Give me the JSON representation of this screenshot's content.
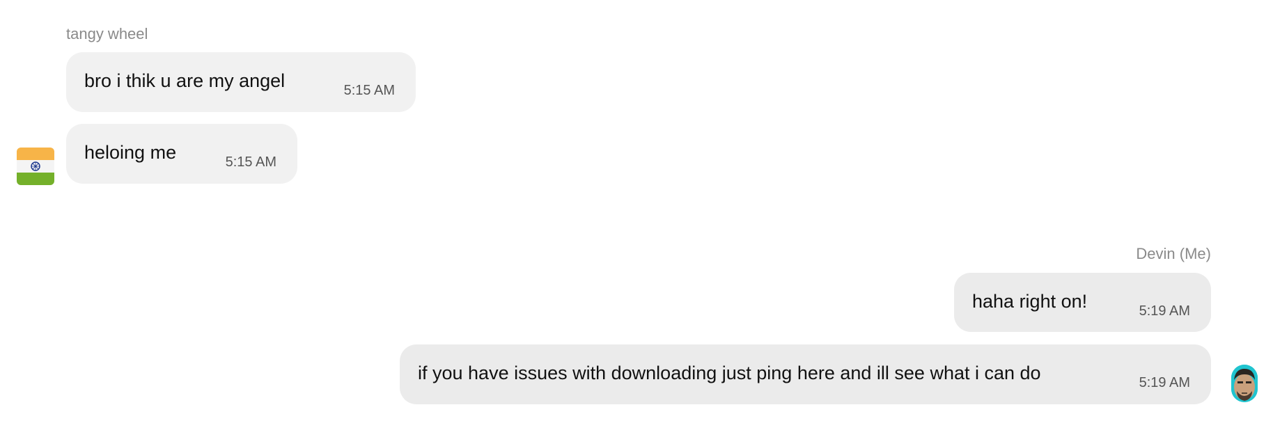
{
  "conversation": {
    "incoming": {
      "sender": "tangy wheel",
      "avatar_icon": "india-flag-icon",
      "colors": {
        "saffron": "#f7b448",
        "white": "#f4f4f4",
        "green": "#74b02a",
        "chakra": "#1f3b8f"
      },
      "messages": [
        {
          "text": "bro i thik u are my angel",
          "time": "5:15 AM"
        },
        {
          "text": "heloing me",
          "time": "5:15 AM"
        }
      ]
    },
    "outgoing": {
      "sender": "Devin (Me)",
      "avatar_icon": "user-avatar-icon",
      "messages": [
        {
          "text": "haha right on!",
          "time": "5:19 AM"
        },
        {
          "text": "if you have issues with downloading just ping here and ill see what i can do",
          "time": "5:19 AM"
        }
      ]
    }
  }
}
